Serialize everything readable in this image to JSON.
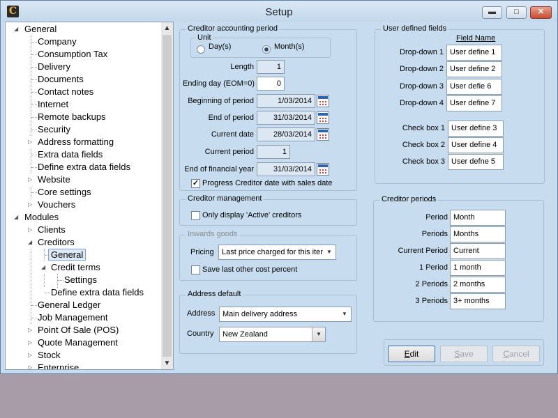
{
  "window": {
    "title": "Setup"
  },
  "tree": {
    "items": [
      {
        "label": "General"
      },
      {
        "label": "Company"
      },
      {
        "label": "Consumption Tax"
      },
      {
        "label": "Delivery"
      },
      {
        "label": "Documents"
      },
      {
        "label": "Contact notes"
      },
      {
        "label": "Internet"
      },
      {
        "label": "Remote backups"
      },
      {
        "label": "Security"
      },
      {
        "label": "Address formatting"
      },
      {
        "label": "Extra data fields"
      },
      {
        "label": "Define extra data fields"
      },
      {
        "label": "Website"
      },
      {
        "label": "Core settings"
      },
      {
        "label": "Vouchers"
      },
      {
        "label": "Modules"
      },
      {
        "label": "Clients"
      },
      {
        "label": "Creditors"
      },
      {
        "label": "General"
      },
      {
        "label": "Credit terms"
      },
      {
        "label": "Settings"
      },
      {
        "label": "Define extra data fields"
      },
      {
        "label": "General Ledger"
      },
      {
        "label": "Job Management"
      },
      {
        "label": "Point Of Sale (POS)"
      },
      {
        "label": "Quote Management"
      },
      {
        "label": "Stock"
      },
      {
        "label": "Enterprise"
      }
    ]
  },
  "creditor_period": {
    "title": "Creditor accounting period",
    "unit": {
      "title": "Unit",
      "days": "Day(s)",
      "months": "Month(s)",
      "selected": "Month(s)"
    },
    "length": {
      "label": "Length",
      "value": "1"
    },
    "ending_day": {
      "label": "Ending day (EOM=0)",
      "value": "0"
    },
    "beginning": {
      "label": "Beginning of period",
      "value": "1/03/2014"
    },
    "end": {
      "label": "End of period",
      "value": "31/03/2014"
    },
    "current_date": {
      "label": "Current date",
      "value": "28/03/2014"
    },
    "current_period": {
      "label": "Current period",
      "value": "1"
    },
    "end_fy": {
      "label": "End of financial year",
      "value": "31/03/2014"
    },
    "progress": {
      "label": "Progress Creditor date with sales date",
      "checked": true
    }
  },
  "creditor_management": {
    "title": "Creditor management",
    "only_active": {
      "label": "Only display 'Active' creditors",
      "checked": false
    }
  },
  "inwards_goods": {
    "title": "Inwards goods",
    "pricing": {
      "label": "Pricing",
      "value": "Last price charged for this item"
    },
    "save_last": {
      "label": "Save last other cost percent",
      "checked": false
    }
  },
  "address_default": {
    "title": "Address default",
    "address": {
      "label": "Address",
      "value": "Main delivery address"
    },
    "country": {
      "label": "Country",
      "value": "New Zealand"
    }
  },
  "user_defined": {
    "title": "User defined fields",
    "header": "Field Name",
    "dropdowns": [
      {
        "label": "Drop-down 1",
        "value": "User define 1"
      },
      {
        "label": "Drop-down 2",
        "value": "User define 2"
      },
      {
        "label": "Drop-down 3",
        "value": "User defie 6"
      },
      {
        "label": "Drop-down 4",
        "value": "User define 7"
      }
    ],
    "checkboxes": [
      {
        "label": "Check box 1",
        "value": "User define 3"
      },
      {
        "label": "Check box 2",
        "value": "User define 4"
      },
      {
        "label": "Check box 3",
        "value": "User defne 5"
      }
    ]
  },
  "creditor_periods": {
    "title": "Creditor periods",
    "rows": [
      {
        "label": "Period",
        "value": "Month"
      },
      {
        "label": "Periods",
        "value": "Months"
      },
      {
        "label": "Current Period",
        "value": "Current"
      },
      {
        "label": "1 Period",
        "value": "1 month"
      },
      {
        "label": "2 Periods",
        "value": "2 months"
      },
      {
        "label": "3 Periods",
        "value": "3+ months"
      }
    ]
  },
  "actions": {
    "edit_prefix": "E",
    "edit_rest": "dit",
    "save_prefix": "S",
    "save_rest": "ave",
    "cancel_prefix": "C",
    "cancel_rest": "ancel"
  },
  "icons": {
    "app": "app-logo-icon",
    "minimize": "minimize-icon",
    "maximize": "maximize-icon",
    "close": "close-icon",
    "calendar": "calendar-icon",
    "dropdown": "chevron-down-icon"
  }
}
